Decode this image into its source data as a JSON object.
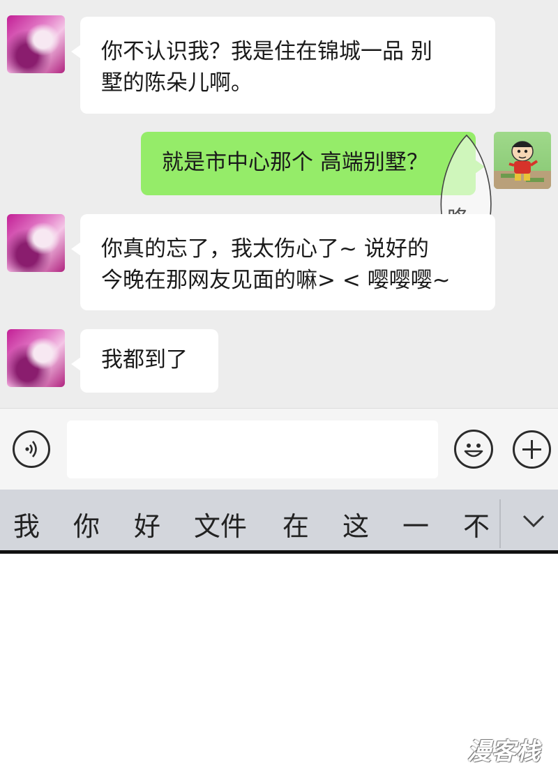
{
  "messages": [
    {
      "from": "left",
      "text": "你不认识我？我是住在锦城一品 别\n墅的陈朵儿啊。"
    },
    {
      "from": "right",
      "text": "就是市中心那个 高端别墅？"
    },
    {
      "from": "left",
      "text": "你真的忘了，我太伤心了~ 说好的\n今晚在那网友见面的嘛> < 嘤嘤嘤~"
    },
    {
      "from": "left",
      "text": "我都到了"
    }
  ],
  "sound_effect": "咚",
  "input": {
    "value": "",
    "placeholder": ""
  },
  "candidates": [
    "我",
    "你",
    "好",
    "文件",
    "在",
    "这",
    "一",
    "不"
  ],
  "icons": {
    "voice": "voice-icon",
    "emoji": "emoji-icon",
    "plus": "plus-icon",
    "collapse": "chevron-down-icon"
  },
  "watermark": "漫客栈",
  "colors": {
    "chat_bg": "#ededed",
    "self_bubble": "#95ec69",
    "other_bubble": "#ffffff",
    "keyboard_bar": "#d3d6dc"
  }
}
